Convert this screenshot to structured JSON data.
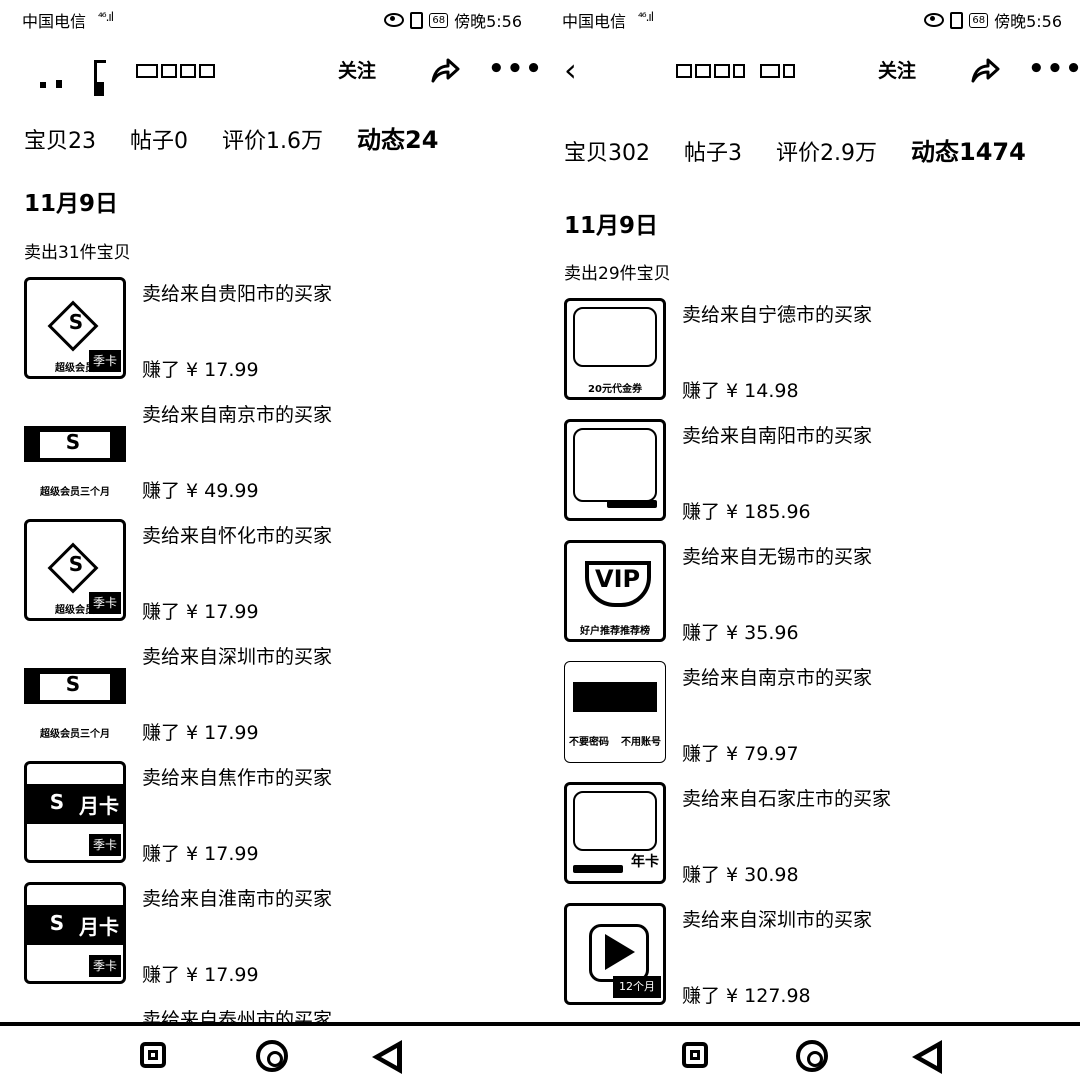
{
  "left": {
    "status": {
      "carrier": "中国电信",
      "signal": "⁴⁶.ıl",
      "battery": "68",
      "time": "傍晚5:56"
    },
    "header": {
      "follow_label": "关注"
    },
    "tabs": [
      {
        "label": "宝贝23"
      },
      {
        "label": "帖子0"
      },
      {
        "label": "评价1.6万"
      },
      {
        "label": "动态24",
        "active": true
      }
    ],
    "date": "11月9日",
    "sold_count": "卖出31件宝贝",
    "items": [
      {
        "title": "卖给来自贵阳市的买家",
        "price": "赚了 ¥ 17.99",
        "thumb": "supervip-card"
      },
      {
        "title": "卖给来自南京市的买家",
        "price": "赚了 ¥ 49.99",
        "thumb": "supervip-3month"
      },
      {
        "title": "卖给来自怀化市的买家",
        "price": "赚了 ¥ 17.99",
        "thumb": "supervip-card"
      },
      {
        "title": "卖给来自深圳市的买家",
        "price": "赚了 ¥ 17.99",
        "thumb": "supervip-3month"
      },
      {
        "title": "卖给来自焦作市的买家",
        "price": "赚了 ¥ 17.99",
        "thumb": "monthly-card"
      },
      {
        "title": "卖给来自淮南市的买家",
        "price": "赚了 ¥ 17.99",
        "thumb": "monthly-card"
      },
      {
        "title": "卖给来自泰州市的买家",
        "price": "",
        "thumb": "supervip-3month"
      }
    ],
    "thumb_text": {
      "three_month": "超级会员三个月",
      "super_member": "超级会员",
      "month_card": "月卡",
      "card_tag": "季卡"
    }
  },
  "right": {
    "status": {
      "carrier": "中国电信",
      "signal": "⁴⁶.ıl",
      "battery": "68",
      "time": "傍晚5:56"
    },
    "header": {
      "follow_label": "关注"
    },
    "tabs": [
      {
        "label": "宝贝302"
      },
      {
        "label": "帖子3"
      },
      {
        "label": "评价2.9万"
      },
      {
        "label": "动态1474",
        "active": true
      }
    ],
    "date": "11月9日",
    "sold_count": "卖出29件宝贝",
    "items": [
      {
        "title": "卖给来自宁德市的买家",
        "price": "赚了 ¥ 14.98",
        "thumb": "voucher-20"
      },
      {
        "title": "卖给来自南阳市的买家",
        "price": "赚了 ¥ 185.96",
        "thumb": "poster"
      },
      {
        "title": "卖给来自无锡市的买家",
        "price": "赚了 ¥ 35.96",
        "thumb": "vip-crown"
      },
      {
        "title": "卖给来自南京市的买家",
        "price": "赚了 ¥ 79.97",
        "thumb": "promo"
      },
      {
        "title": "卖给来自石家庄市的买家",
        "price": "赚了 ¥ 30.98",
        "thumb": "year-card"
      },
      {
        "title": "卖给来自深圳市的买家",
        "price": "赚了 ¥ 127.98",
        "thumb": "video-12month"
      }
    ],
    "thumb_text": {
      "voucher": "20元代金券",
      "year_card": "年卡",
      "crown": "VIP",
      "crown_sub": "好户推荐推荐榜",
      "promo_a": "不要密码",
      "promo_b": "不用账号",
      "video": "12个月"
    }
  },
  "navbar": {
    "icons": [
      "recent-apps-icon",
      "home-icon",
      "back-icon"
    ]
  }
}
